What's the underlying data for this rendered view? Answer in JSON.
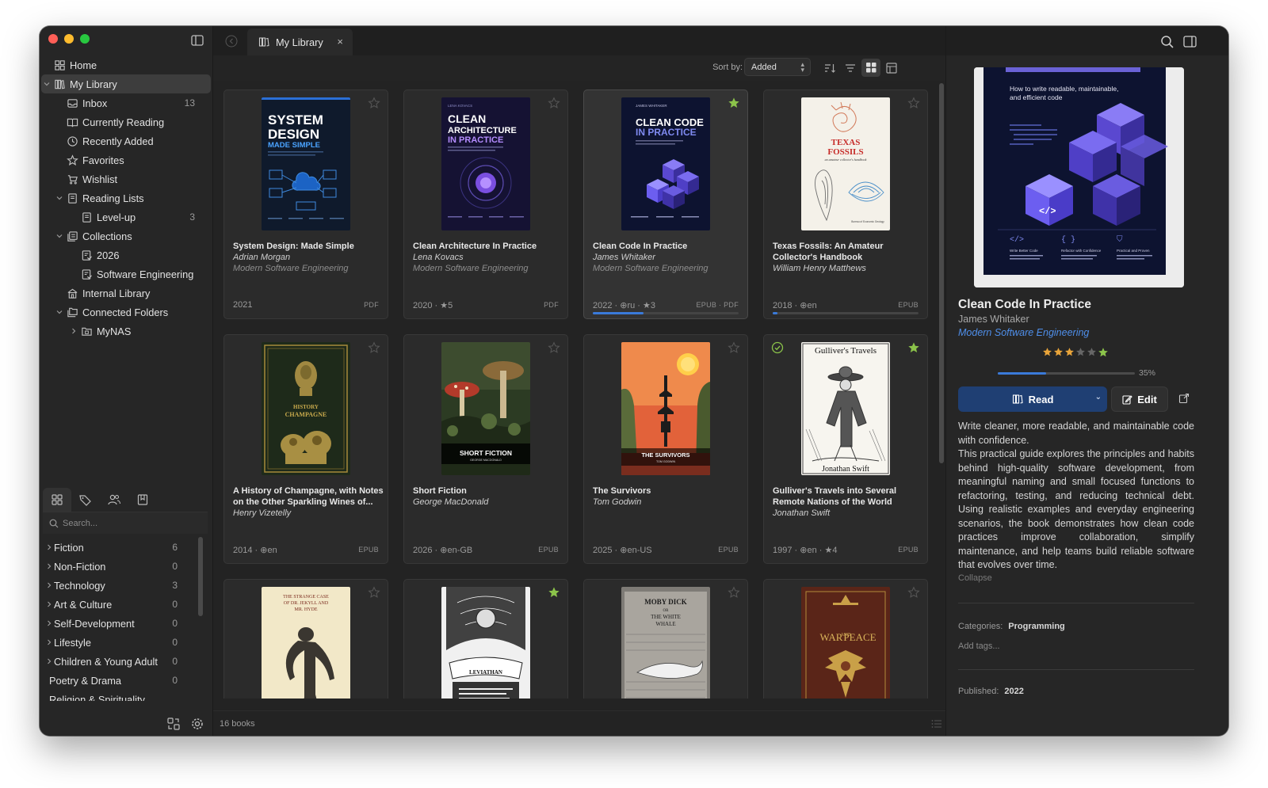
{
  "sidebar": {
    "nav": [
      {
        "label": "Home",
        "icon": "home-grid-icon",
        "level": 0,
        "count": ""
      },
      {
        "label": "My Library",
        "icon": "library-icon",
        "level": 0,
        "expanded": true,
        "active": true,
        "count": ""
      },
      {
        "label": "Inbox",
        "icon": "inbox-icon",
        "level": 1,
        "count": "13"
      },
      {
        "label": "Currently Reading",
        "icon": "open-book-icon",
        "level": 1,
        "count": ""
      },
      {
        "label": "Recently Added",
        "icon": "clock-icon",
        "level": 1,
        "count": ""
      },
      {
        "label": "Favorites",
        "icon": "star-icon",
        "level": 1,
        "count": ""
      },
      {
        "label": "Wishlist",
        "icon": "cart-icon",
        "level": 1,
        "count": ""
      },
      {
        "label": "Reading Lists",
        "icon": "list-book-icon",
        "level": 1,
        "expanded": true,
        "count": ""
      },
      {
        "label": "Level-up",
        "icon": "list-book-icon",
        "level": 2,
        "count": "3"
      },
      {
        "label": "Collections",
        "icon": "collections-icon",
        "level": 1,
        "expanded": true,
        "count": ""
      },
      {
        "label": "2026",
        "icon": "collection-list-icon",
        "level": 2,
        "count": ""
      },
      {
        "label": "Software Engineering",
        "icon": "collection-list-icon",
        "level": 2,
        "count": ""
      },
      {
        "label": "Internal Library",
        "icon": "building-icon",
        "level": 1,
        "count": ""
      },
      {
        "label": "Connected Folders",
        "icon": "folders-icon",
        "level": 1,
        "expanded": true,
        "count": ""
      },
      {
        "label": "MyNAS",
        "icon": "nas-folder-icon",
        "level": 2,
        "collapsed": true,
        "count": ""
      }
    ],
    "search_placeholder": "Search...",
    "categories": [
      {
        "label": "Fiction",
        "count": "6",
        "chev": true
      },
      {
        "label": "Non-Fiction",
        "count": "0",
        "chev": true
      },
      {
        "label": "Technology",
        "count": "3",
        "chev": true
      },
      {
        "label": "Art & Culture",
        "count": "0",
        "chev": true
      },
      {
        "label": "Self-Development",
        "count": "0",
        "chev": true
      },
      {
        "label": "Lifestyle",
        "count": "0",
        "chev": true
      },
      {
        "label": "Children & Young Adult",
        "count": "0",
        "chev": true
      },
      {
        "label": "Poetry & Drama",
        "count": "0",
        "chev": false
      },
      {
        "label": "Religion & Spirituality",
        "count": "",
        "chev": false
      }
    ]
  },
  "tab": {
    "label": "My Library",
    "close": "×"
  },
  "toolbar": {
    "sort_label": "Sort by:",
    "sort_value": "Added"
  },
  "books": [
    {
      "title": "System Design: Made Simple",
      "author": "Adrian Morgan",
      "series": "Modern Software Engineering",
      "meta": "2021",
      "format": "PDF",
      "favorite": false,
      "selected": false,
      "read": false,
      "progress": null,
      "cover_text": [
        "SYSTEM",
        "DESIGN",
        "MADE SIMPLE"
      ]
    },
    {
      "title": "Clean Architecture In Practice",
      "author": "Lena Kovacs",
      "series": "Modern Software Engineering",
      "meta": "2020 · ★5",
      "format": "PDF",
      "favorite": false,
      "selected": false,
      "read": false,
      "progress": null,
      "cover_text": [
        "CLEAN",
        "ARCHITECTURE",
        "IN PRACTICE"
      ]
    },
    {
      "title": "Clean Code In Practice",
      "author": "James Whitaker",
      "series": "Modern Software Engineering",
      "meta": "2022 · ⊕ru · ★3",
      "format": "EPUB · PDF",
      "favorite": true,
      "selected": true,
      "read": false,
      "progress": 0.35,
      "cover_text": [
        "CLEAN CODE",
        "IN PRACTICE"
      ]
    },
    {
      "title": "Texas Fossils: An Amateur Collector's Handbook",
      "author": "William Henry Matthews",
      "series": "",
      "meta": "2018 · ⊕en",
      "format": "EPUB",
      "favorite": false,
      "selected": false,
      "read": false,
      "progress": 0.03,
      "cover_text": [
        "TEXAS",
        "FOSSILS",
        "an amateur collector's handbook"
      ]
    },
    {
      "title": "A History of Champagne, with Notes on the Other Sparkling Wines of...",
      "author": "Henry Vizetelly",
      "series": "",
      "meta": "2014 · ⊕en",
      "format": "EPUB",
      "favorite": false,
      "selected": false,
      "read": false,
      "progress": null,
      "cover_text": []
    },
    {
      "title": "Short Fiction",
      "author": "George MacDonald",
      "series": "",
      "meta": "2026 · ⊕en-GB",
      "format": "EPUB",
      "favorite": false,
      "selected": false,
      "read": false,
      "progress": null,
      "cover_text": [
        "SHORT FICTION",
        "GEORGE MACDONALD"
      ]
    },
    {
      "title": "The Survivors",
      "author": "Tom Godwin",
      "series": "",
      "meta": "2025 · ⊕en-US",
      "format": "EPUB",
      "favorite": false,
      "selected": false,
      "read": false,
      "progress": null,
      "cover_text": [
        "THE SURVIVORS",
        "TOM GODWIN"
      ]
    },
    {
      "title": "Gulliver's Travels into Several Remote Nations of the World",
      "author": "Jonathan Swift",
      "series": "",
      "meta": "1997 · ⊕en · ★4",
      "format": "EPUB",
      "favorite": true,
      "selected": false,
      "read": true,
      "progress": null,
      "cover_text": [
        "Gulliver's Travels",
        "Jonathan Swift"
      ]
    },
    {
      "title": "",
      "author": "",
      "series": "",
      "meta": "",
      "format": "",
      "favorite": false,
      "selected": false,
      "read": false,
      "progress": null,
      "cover_text": [
        "THE STRANGE CASE",
        "OF DR. JEKYLL AND",
        "MR. HYDE"
      ]
    },
    {
      "title": "",
      "author": "",
      "series": "",
      "meta": "",
      "format": "",
      "favorite": true,
      "selected": false,
      "read": false,
      "progress": null,
      "cover_text": [
        "LEVIATHAN"
      ]
    },
    {
      "title": "",
      "author": "",
      "series": "",
      "meta": "",
      "format": "",
      "favorite": false,
      "selected": false,
      "read": false,
      "progress": null,
      "cover_text": [
        "MOBY DICK",
        "OR",
        "THE WHITE",
        "WHALE"
      ]
    },
    {
      "title": "",
      "author": "",
      "series": "",
      "meta": "",
      "format": "",
      "favorite": false,
      "selected": false,
      "read": false,
      "progress": null,
      "cover_text": [
        "WAR AND PEACE"
      ]
    }
  ],
  "statusbar": {
    "count": "16 books"
  },
  "detail": {
    "title": "Clean Code In Practice",
    "author": "James Whitaker",
    "series": "Modern Software Engineering",
    "rating": 3,
    "rating_max": 5,
    "favorite": true,
    "progress": 0.35,
    "progress_label": "35%",
    "read_label": "Read",
    "edit_label": "Edit",
    "description": [
      "Write cleaner, more readable, and maintainable code with confidence.",
      "This practical guide explores the principles and habits behind high-quality software development, from meaningful naming and small focused functions to refactoring, testing, and reducing technical debt. Using realistic examples and everyday engineering scenarios, the book demonstrates how clean code practices improve collaboration, simplify maintenance, and help teams build reliable software that evolves over time."
    ],
    "collapse_label": "Collapse",
    "categories_label": "Categories:",
    "categories_value": "Programming",
    "add_tags": "Add tags...",
    "published_label": "Published:",
    "published_value": "2022",
    "cover_text": {
      "tagline": "How to write readable, maintainable, and efficient code",
      "features": [
        {
          "title": "Write Better Code",
          "text": "Principles and patterns for writing clean, understandable code"
        },
        {
          "title": "Refactor with Confidence",
          "text": "Improve code quality without changing behavior"
        },
        {
          "title": "Practical and Proven",
          "text": "Real-world techniques for professional developers"
        }
      ]
    }
  },
  "colors": {
    "accent": "#3a7ad9",
    "favorite": "#8bc34a",
    "rating": "#e8a43a",
    "series_link": "#4f8fea",
    "read_button": "#1f3f73"
  }
}
